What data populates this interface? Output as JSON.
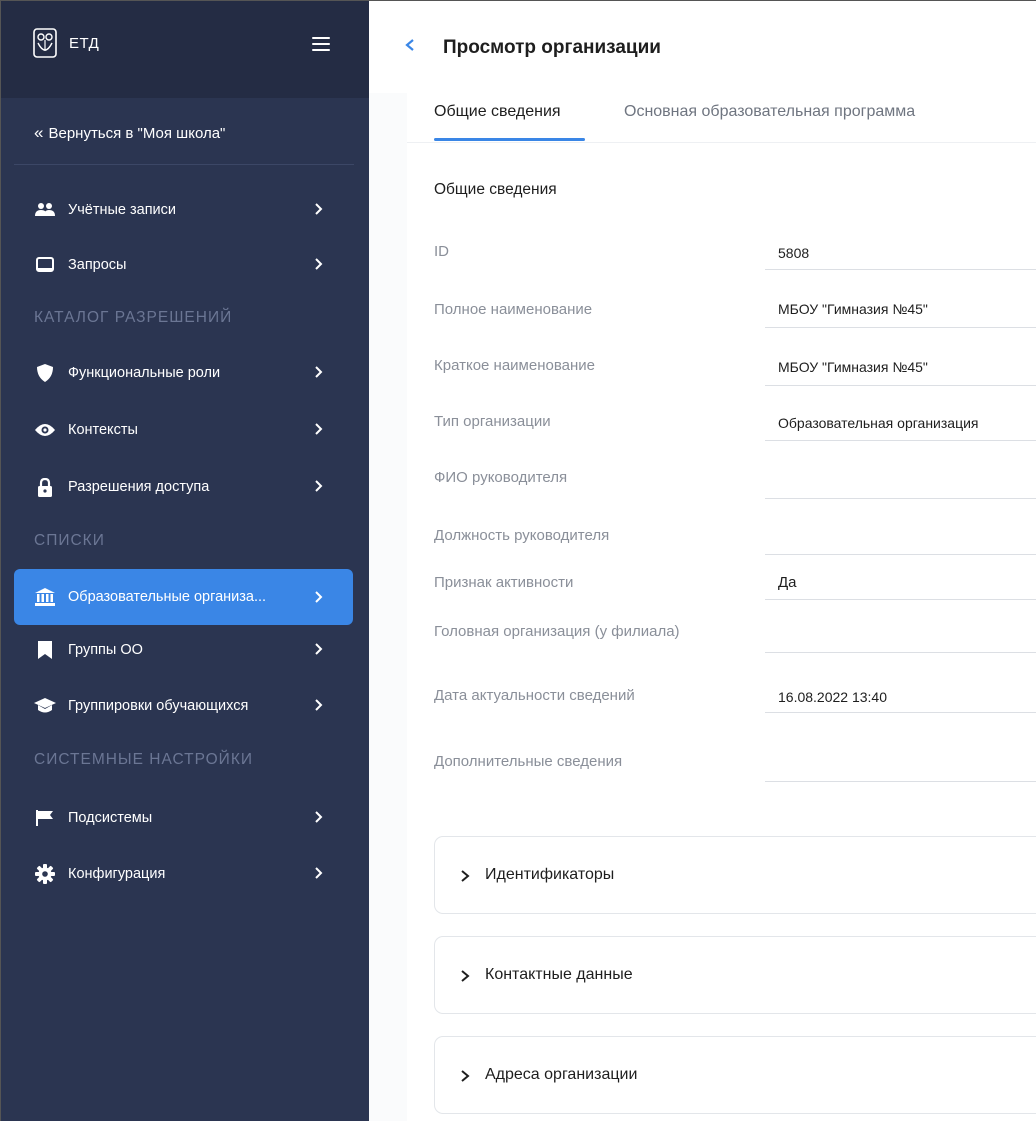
{
  "app": {
    "title": "ЕТД"
  },
  "sidebar": {
    "back_label": "Вернуться в \"Моя школа\"",
    "items_group1": [
      {
        "label": "Учётные записи",
        "icon": "users-icon"
      },
      {
        "label": "Запросы",
        "icon": "inbox-icon"
      }
    ],
    "section_permissions": "КАТАЛОГ РАЗРЕШЕНИЙ",
    "items_group2": [
      {
        "label": "Функциональные роли",
        "icon": "shield-icon"
      },
      {
        "label": "Контексты",
        "icon": "eye-icon"
      },
      {
        "label": "Разрешения доступа",
        "icon": "lock-icon"
      }
    ],
    "section_lists": "СПИСКИ",
    "items_group3": [
      {
        "label": "Образовательные организа...",
        "icon": "institution-icon",
        "active": true
      },
      {
        "label": "Группы ОО",
        "icon": "bookmark-icon"
      },
      {
        "label": "Группировки обучающихся",
        "icon": "graduation-cap-icon"
      }
    ],
    "section_system": "СИСТЕМНЫЕ НАСТРОЙКИ",
    "items_group4": [
      {
        "label": "Подсистемы",
        "icon": "flag-icon"
      },
      {
        "label": "Конфигурация",
        "icon": "gear-icon"
      }
    ]
  },
  "header": {
    "title": "Просмотр организации"
  },
  "tabs": [
    {
      "label": "Общие сведения",
      "active": true
    },
    {
      "label": "Основная образовательная программа",
      "active": false
    }
  ],
  "general": {
    "title": "Общие сведения",
    "fields": [
      {
        "label": "ID",
        "value": "5808"
      },
      {
        "label": "Полное наименование",
        "value": "МБОУ \"Гимназия №45\""
      },
      {
        "label": "Краткое наименование",
        "value": "МБОУ \"Гимназия №45\""
      },
      {
        "label": "Тип организации",
        "value": "Образовательная организация"
      },
      {
        "label": "ФИО руководителя",
        "value": ""
      },
      {
        "label": "Должность руководителя",
        "value": ""
      },
      {
        "label": "Признак активности",
        "value": "Да"
      },
      {
        "label": "Головная организация (у филиала)",
        "value": ""
      },
      {
        "label": "Дата актуальности сведений",
        "value": "16.08.2022 13:40"
      },
      {
        "label": "Дополнительные сведения",
        "value": ""
      }
    ]
  },
  "accordions": [
    {
      "title": "Идентификаторы"
    },
    {
      "title": "Контактные данные"
    },
    {
      "title": "Адреса организации"
    }
  ],
  "colors": {
    "sidebar_bg": "#2b3551",
    "sidebar_top_bg": "#242c44",
    "accent": "#3a86e6"
  }
}
